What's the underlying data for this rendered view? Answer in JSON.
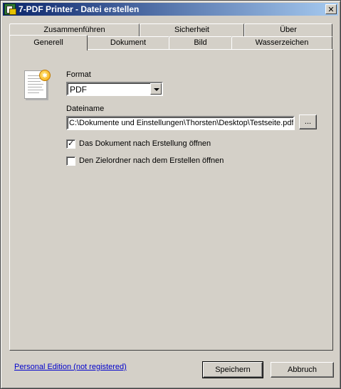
{
  "window": {
    "title": "7-PDF Printer - Datei erstellen",
    "close_glyph": "✕",
    "accent": "#0a246a",
    "face": "#d4d0c8"
  },
  "tabs": {
    "row_back": [
      "Zusammenführen",
      "Sicherheit",
      "Über"
    ],
    "row_front": [
      "Generell",
      "Dokument",
      "Bild",
      "Wasserzeichen"
    ],
    "active": "Generell"
  },
  "general": {
    "icon": "document-icon",
    "format_label": "Format",
    "format_value": "PDF",
    "filename_label": "Dateiname",
    "filename_value": "C:\\Dokumente und Einstellungen\\Thorsten\\Desktop\\Testseite.pdf",
    "browse_label": "...",
    "open_document_label": "Das Dokument nach Erstellung öffnen",
    "open_document_checked": true,
    "open_folder_label": "Den Zielordner nach dem Erstellen öffnen",
    "open_folder_checked": false,
    "check_glyph": "✓"
  },
  "footer": {
    "edition_link": "Personal Edition (not registered)",
    "save_label": "Speichern",
    "cancel_label": "Abbruch"
  }
}
